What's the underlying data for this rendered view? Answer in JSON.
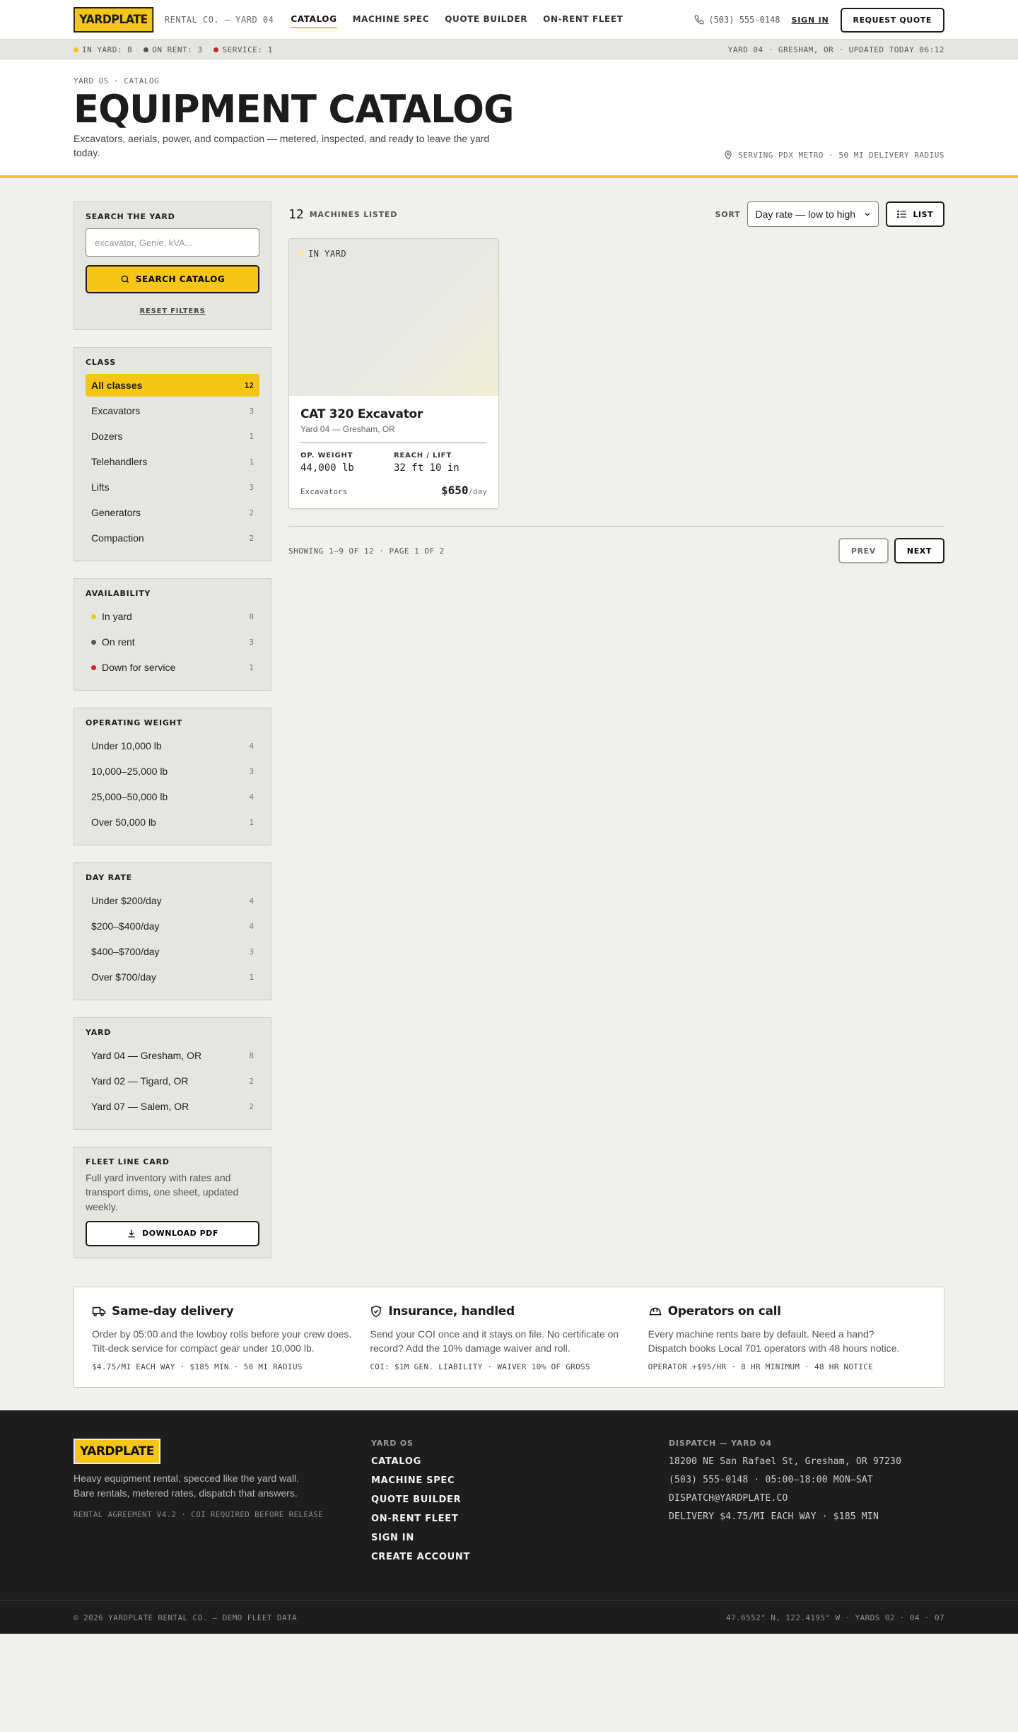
{
  "brand": {
    "logo": "YARDPLATE",
    "subtitle": "RENTAL CO. — YARD 04"
  },
  "nav": {
    "links": [
      "CATALOG",
      "MACHINE SPEC",
      "QUOTE BUILDER",
      "ON-RENT FLEET"
    ],
    "phone": "(503) 555-0148",
    "sign_in": "SIGN IN",
    "request_quote": "REQUEST QUOTE"
  },
  "status": {
    "in_yard": "IN YARD: 8",
    "on_rent": "ON RENT: 3",
    "service": "SERVICE: 1",
    "right": "YARD 04 · GRESHAM, OR · UPDATED TODAY 06:12"
  },
  "colors": {
    "accent": "#f5c518",
    "in_yard": "#f5c518",
    "on_rent": "#555555",
    "service": "#c62828"
  },
  "header": {
    "breadcrumb": "YARD OS · CATALOG",
    "title": "EQUIPMENT CATALOG",
    "lede": "Excavators, aerials, power, and compaction — metered, inspected, and ready to leave the yard today.",
    "serving": "SERVING PDX METRO · 50 MI DELIVERY RADIUS"
  },
  "search": {
    "heading": "SEARCH THE YARD",
    "placeholder": "excavator, Genie, kVA...",
    "button": "SEARCH CATALOG",
    "reset": "RESET FILTERS"
  },
  "filters": {
    "class": {
      "heading": "CLASS",
      "items": [
        {
          "label": "All classes",
          "count": "12"
        },
        {
          "label": "Excavators",
          "count": "3"
        },
        {
          "label": "Dozers",
          "count": "1"
        },
        {
          "label": "Telehandlers",
          "count": "1"
        },
        {
          "label": "Lifts",
          "count": "3"
        },
        {
          "label": "Generators",
          "count": "2"
        },
        {
          "label": "Compaction",
          "count": "2"
        }
      ]
    },
    "availability": {
      "heading": "AVAILABILITY",
      "items": [
        {
          "label": "In yard",
          "count": "8"
        },
        {
          "label": "On rent",
          "count": "3"
        },
        {
          "label": "Down for service",
          "count": "1"
        }
      ]
    },
    "weight": {
      "heading": "OPERATING WEIGHT",
      "items": [
        {
          "label": "Under 10,000 lb",
          "count": "4"
        },
        {
          "label": "10,000–25,000 lb",
          "count": "3"
        },
        {
          "label": "25,000–50,000 lb",
          "count": "4"
        },
        {
          "label": "Over 50,000 lb",
          "count": "1"
        }
      ]
    },
    "rate": {
      "heading": "DAY RATE",
      "items": [
        {
          "label": "Under $200/day",
          "count": "4"
        },
        {
          "label": "$200–$400/day",
          "count": "4"
        },
        {
          "label": "$400–$700/day",
          "count": "3"
        },
        {
          "label": "Over $700/day",
          "count": "1"
        }
      ]
    },
    "yard": {
      "heading": "YARD",
      "items": [
        {
          "label": "Yard 04 — Gresham, OR",
          "count": "8"
        },
        {
          "label": "Yard 02 — Tigard, OR",
          "count": "2"
        },
        {
          "label": "Yard 07 — Salem, OR",
          "count": "2"
        }
      ]
    }
  },
  "linecard": {
    "heading": "FLEET LINE CARD",
    "text": "Full yard inventory with rates and transport dims, one sheet, updated weekly.",
    "button": "DOWNLOAD PDF"
  },
  "results": {
    "count": "12",
    "count_label": "MACHINES LISTED",
    "sort_label": "SORT",
    "sort_value": "Day rate — low to high",
    "list_button": "LIST"
  },
  "card": {
    "badge": "IN YARD",
    "title": "CAT 320 Excavator",
    "location": "Yard 04 — Gresham, OR",
    "spec1_label": "OP. WEIGHT",
    "spec1_value": "44,000 lb",
    "spec2_label": "REACH / LIFT",
    "spec2_value": "32 ft 10 in",
    "class": "Excavators",
    "price": "$650",
    "per": "/day"
  },
  "pagination": {
    "info": "SHOWING 1–9 OF 12 · PAGE 1 OF 2",
    "prev": "PREV",
    "next": "NEXT"
  },
  "features": [
    {
      "icon": "truck-icon",
      "title": "Same-day delivery",
      "text": "Order by 05:00 and the lowboy rolls before your crew does. Tilt-deck service for compact gear under 10,000 lb.",
      "meta": "$4.75/MI EACH WAY · $185 MIN · 50 MI RADIUS"
    },
    {
      "icon": "shield-icon",
      "title": "Insurance, handled",
      "text": "Send your COI once and it stays on file. No certificate on record? Add the 10% damage waiver and roll.",
      "meta": "COI: $1M GEN. LIABILITY · WAIVER 10% OF GROSS"
    },
    {
      "icon": "hardhat-icon",
      "title": "Operators on call",
      "text": "Every machine rents bare by default. Need a hand? Dispatch books Local 701 operators with 48 hours notice.",
      "meta": "OPERATOR +$95/HR · 8 HR MINIMUM · 48 HR NOTICE"
    }
  ],
  "footer": {
    "logo": "YARDPLATE",
    "description": "Heavy equipment rental, specced like the yard wall. Bare rentals, metered rates, dispatch that answers.",
    "legal": "RENTAL AGREEMENT V4.2 · COI REQUIRED BEFORE RELEASE",
    "nav_heading": "YARD OS",
    "nav_links": [
      "CATALOG",
      "MACHINE SPEC",
      "QUOTE BUILDER",
      "ON-RENT FLEET",
      "SIGN IN",
      "CREATE ACCOUNT"
    ],
    "dispatch_heading": "DISPATCH — YARD 04",
    "dispatch_lines": [
      "18200 NE San Rafael St, Gresham, OR 97230",
      "(503) 555-0148 · 05:00–18:00 MON–SAT",
      "DISPATCH@YARDPLATE.CO",
      "DELIVERY $4.75/MI EACH WAY · $185 MIN"
    ],
    "copyright": "© 2026 YARDPLATE RENTAL CO. — DEMO FLEET DATA",
    "coords": "47.6552° N, 122.4195° W · YARDS 02 · 04 · 07"
  }
}
